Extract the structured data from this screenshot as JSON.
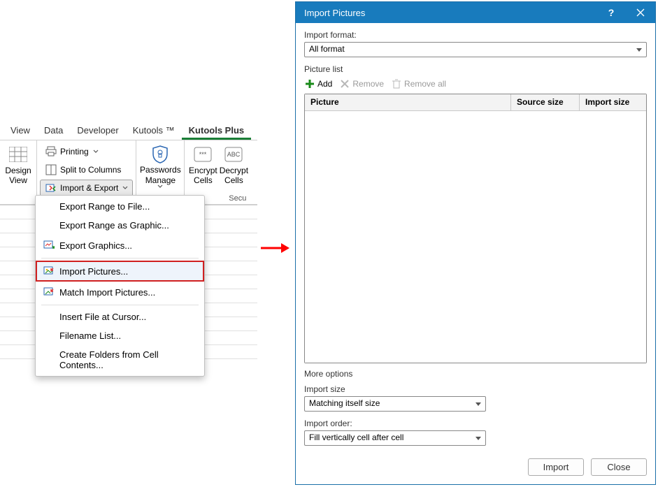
{
  "ribbon": {
    "tabs": [
      "View",
      "Data",
      "Developer",
      "Kutools ™",
      "Kutools Plus"
    ],
    "active_tab": "Kutools Plus",
    "design_view": "Design\nView",
    "printing": "Printing",
    "split_cols": "Split to Columns",
    "import_export": "Import & Export",
    "passwords": "Passwords\nManage",
    "encrypt": "Encrypt\nCells",
    "decrypt": "Decrypt\nCells",
    "security_label": "Secu"
  },
  "menu": {
    "export_range_file": "Export Range to File...",
    "export_range_graphic": "Export Range as Graphic...",
    "export_graphics": "Export Graphics...",
    "import_pictures": "Import Pictures...",
    "match_import": "Match Import Pictures...",
    "insert_file": "Insert File at Cursor...",
    "filename_list": "Filename List...",
    "create_folders": "Create Folders from Cell Contents..."
  },
  "dialog": {
    "title": "Import Pictures",
    "import_format_label": "Import format:",
    "import_format_value": "All format",
    "picture_list_label": "Picture list",
    "add": "Add",
    "remove": "Remove",
    "remove_all": "Remove all",
    "col_picture": "Picture",
    "col_source_size": "Source size",
    "col_import_size": "Import size",
    "more_options_label": "More options",
    "import_size_label": "Import size",
    "import_size_value": "Matching itself size",
    "import_order_label": "Import order:",
    "import_order_value": "Fill vertically cell after cell",
    "btn_import": "Import",
    "btn_close": "Close"
  }
}
